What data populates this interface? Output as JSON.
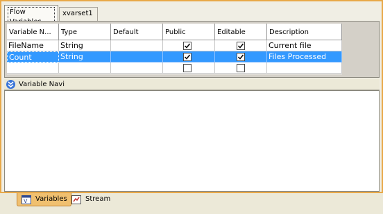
{
  "tabs": [
    {
      "label": "Flow Variables",
      "active": true
    },
    {
      "label": "xvarset1",
      "active": false
    }
  ],
  "table": {
    "columns": [
      "Variable N...",
      "Type",
      "Default",
      "Public",
      "Editable",
      "Description"
    ],
    "rows": [
      {
        "name": "FileName",
        "type": "String",
        "default": "",
        "public": true,
        "editable": true,
        "description": "Current file",
        "selected": false
      },
      {
        "name": "Count",
        "type": "String",
        "default": "",
        "public": true,
        "editable": true,
        "description": "Files Processed",
        "selected": true
      },
      {
        "name": "",
        "type": "",
        "default": "",
        "public": false,
        "editable": false,
        "description": "",
        "selected": false
      }
    ]
  },
  "navigator": {
    "title": "Variable Navi",
    "icon": "chevron-double-down-icon"
  },
  "bottom_tabs": [
    {
      "label": "Variables",
      "icon": "variables-icon",
      "active": true
    },
    {
      "label": "Stream",
      "icon": "stream-icon",
      "active": false
    }
  ],
  "colors": {
    "accent_border": "#e8a848",
    "selection": "#3399ff",
    "active_tab": "#f0c070"
  }
}
